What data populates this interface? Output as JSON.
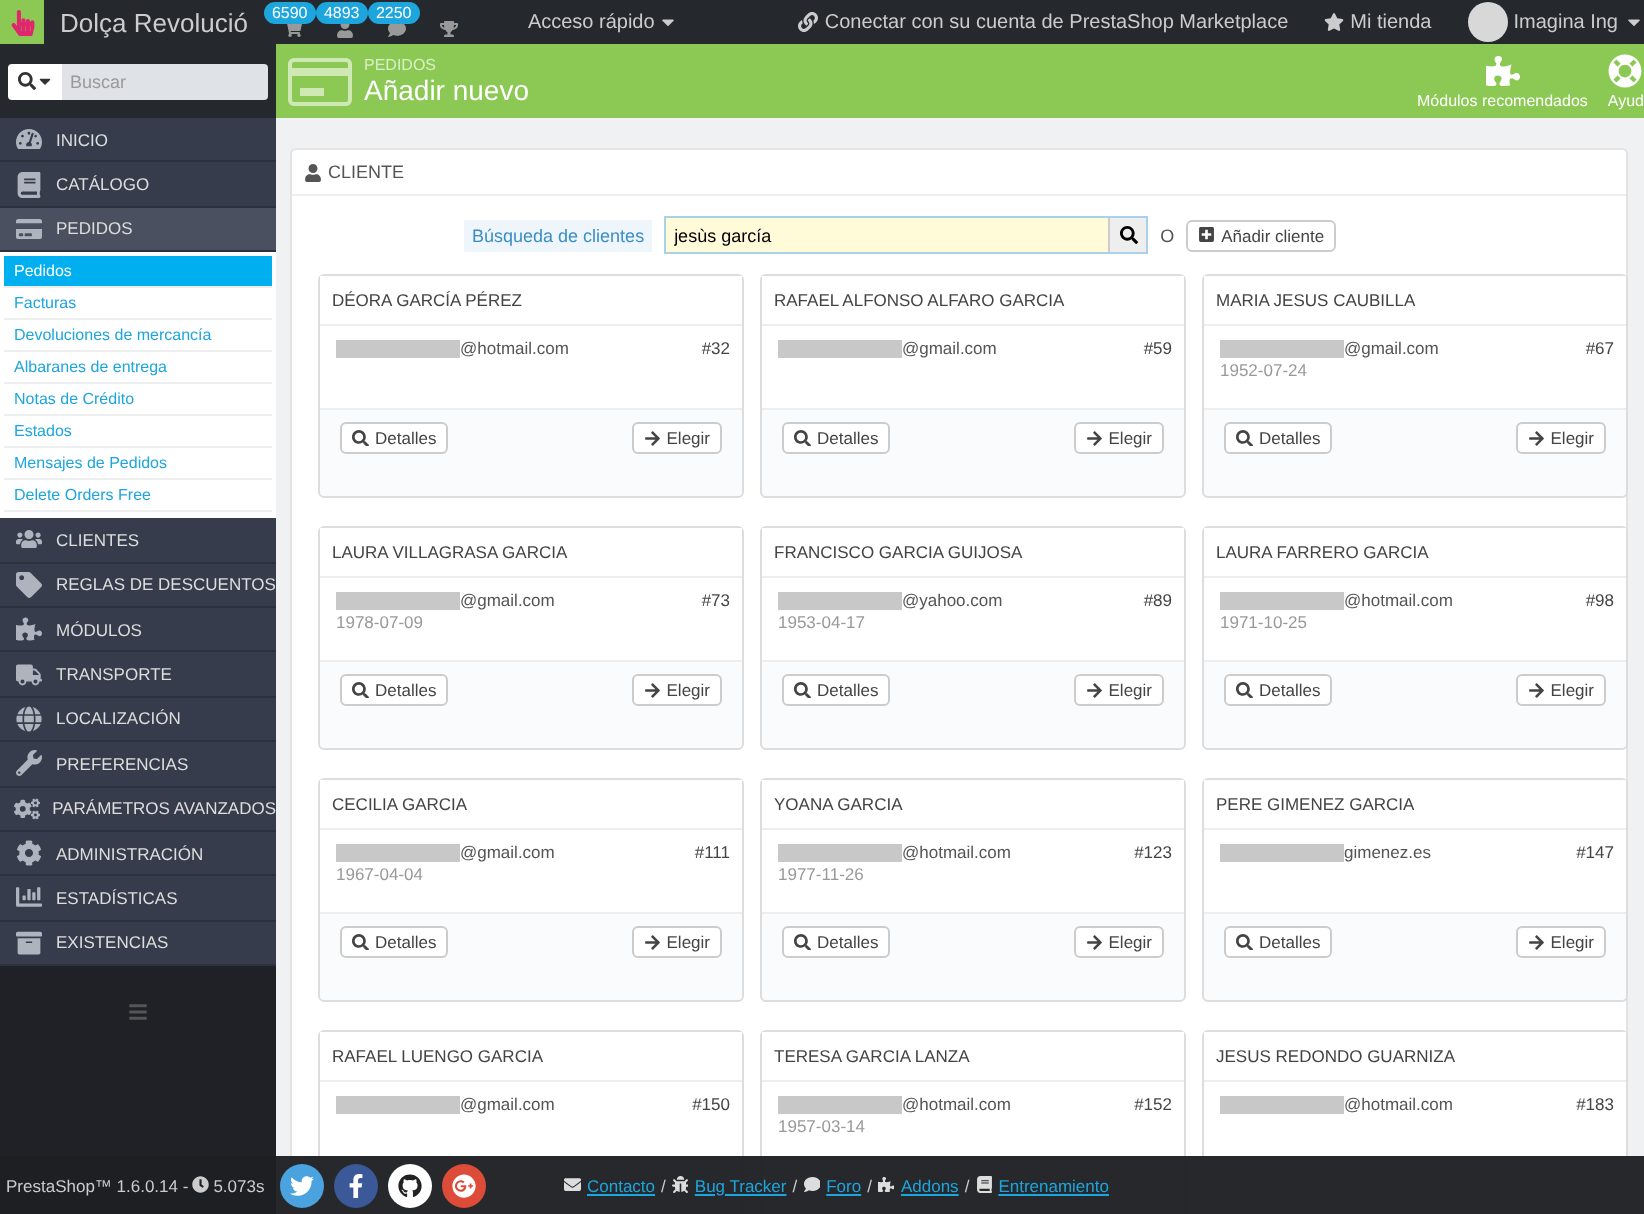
{
  "topbar": {
    "shop_name": "Dolça Revolució",
    "badges": [
      {
        "kind": "cart",
        "count": "6590"
      },
      {
        "kind": "user",
        "count": "4893"
      },
      {
        "kind": "message",
        "count": "2250"
      }
    ],
    "quick_access": "Acceso rápido",
    "marketplace": "Conectar con su cuenta de PrestaShop Marketplace",
    "my_shop": "Mi tienda",
    "user": "Imagina Ing"
  },
  "sidebar": {
    "search_placeholder": "Buscar",
    "items": [
      {
        "label": "INICIO",
        "kind": "dashboard",
        "selected": false
      },
      {
        "label": "CATÁLOGO",
        "kind": "book",
        "selected": false
      },
      {
        "label": "PEDIDOS",
        "kind": "card",
        "selected": true,
        "children": [
          {
            "label": "Pedidos",
            "selected": true
          },
          {
            "label": "Facturas",
            "selected": false
          },
          {
            "label": "Devoluciones de mercancía",
            "selected": false
          },
          {
            "label": "Albaranes de entrega",
            "selected": false
          },
          {
            "label": "Notas de Crédito",
            "selected": false
          },
          {
            "label": "Estados",
            "selected": false
          },
          {
            "label": "Mensajes de Pedidos",
            "selected": false
          },
          {
            "label": "Delete Orders Free",
            "selected": false
          }
        ]
      },
      {
        "label": "CLIENTES",
        "kind": "users",
        "selected": false
      },
      {
        "label": "REGLAS DE DESCUENTOS",
        "kind": "tag",
        "selected": false
      },
      {
        "label": "MÓDULOS",
        "kind": "puzzle",
        "selected": false
      },
      {
        "label": "TRANSPORTE",
        "kind": "truck",
        "selected": false
      },
      {
        "label": "LOCALIZACIÓN",
        "kind": "globe",
        "selected": false
      },
      {
        "label": "PREFERENCIAS",
        "kind": "wrench",
        "selected": false
      },
      {
        "label": "PARÁMETROS AVANZADOS",
        "kind": "cogs",
        "selected": false
      },
      {
        "label": "ADMINISTRACIÓN",
        "kind": "cog",
        "selected": false
      },
      {
        "label": "ESTADÍSTICAS",
        "kind": "chart",
        "selected": false
      },
      {
        "label": "EXISTENCIAS",
        "kind": "box",
        "selected": false
      }
    ],
    "version": "PrestaShop™ 1.6.0.14 -",
    "load_time": "5.073s"
  },
  "header": {
    "breadcrumb": "PEDIDOS",
    "title": "Añadir nuevo",
    "actions": [
      {
        "kind": "puzzle",
        "label": "Módulos recomendados"
      },
      {
        "kind": "help",
        "label": "Ayud"
      }
    ]
  },
  "panel": {
    "title": "CLIENTE",
    "search_label": "Búsqueda de clientes",
    "search_value": "jesùs garcía",
    "or": "O",
    "add_button": "Añadir cliente",
    "customers": [
      {
        "name": "DÉORA GARCÍA PÉREZ",
        "email": "@hotmail.com",
        "id": "#32",
        "details": "Detalles",
        "choose": "Elegir"
      },
      {
        "name": "RAFAEL ALFONSO ALFARO GARCIA",
        "email": "@gmail.com",
        "id": "#59",
        "details": "Detalles",
        "choose": "Elegir"
      },
      {
        "name": "MARIA JESUS CAUBILLA",
        "email": "@gmail.com",
        "id": "#67",
        "birthdate": "1952-07-24",
        "details": "Detalles",
        "choose": "Elegir"
      },
      {
        "name": "LAURA VILLAGRASA GARCIA",
        "email": "@gmail.com",
        "id": "#73",
        "birthdate": "1978-07-09",
        "details": "Detalles",
        "choose": "Elegir"
      },
      {
        "name": "FRANCISCO GARCIA GUIJOSA",
        "email": "@yahoo.com",
        "id": "#89",
        "birthdate": "1953-04-17",
        "details": "Detalles",
        "choose": "Elegir"
      },
      {
        "name": "LAURA FARRERO GARCIA",
        "email": "@hotmail.com",
        "id": "#98",
        "birthdate": "1971-10-25",
        "details": "Detalles",
        "choose": "Elegir"
      },
      {
        "name": "CECILIA GARCIA",
        "email": "@gmail.com",
        "id": "#111",
        "birthdate": "1967-04-04",
        "details": "Detalles",
        "choose": "Elegir"
      },
      {
        "name": "YOANA GARCIA",
        "email": "@hotmail.com",
        "id": "#123",
        "birthdate": "1977-11-26",
        "details": "Detalles",
        "choose": "Elegir"
      },
      {
        "name": "PERE GIMENEZ GARCIA",
        "email": "gimenez.es",
        "id": "#147",
        "details": "Detalles",
        "choose": "Elegir"
      },
      {
        "name": "RAFAEL LUENGO GARCIA",
        "email": "@gmail.com",
        "id": "#150"
      },
      {
        "name": "TERESA GARCIA LANZA",
        "email": "@hotmail.com",
        "id": "#152",
        "birthdate": "1957-03-14"
      },
      {
        "name": "JESUS REDONDO GUARNIZA",
        "email": "@hotmail.com",
        "id": "#183"
      }
    ]
  },
  "footer": {
    "links": [
      {
        "kind": "mail",
        "label": "Contacto"
      },
      {
        "kind": "bug",
        "label": "Bug Tracker"
      },
      {
        "kind": "chat",
        "label": "Foro"
      },
      {
        "kind": "puzzle",
        "label": "Addons"
      },
      {
        "kind": "book",
        "label": "Entrenamiento"
      }
    ],
    "separator": "/"
  }
}
